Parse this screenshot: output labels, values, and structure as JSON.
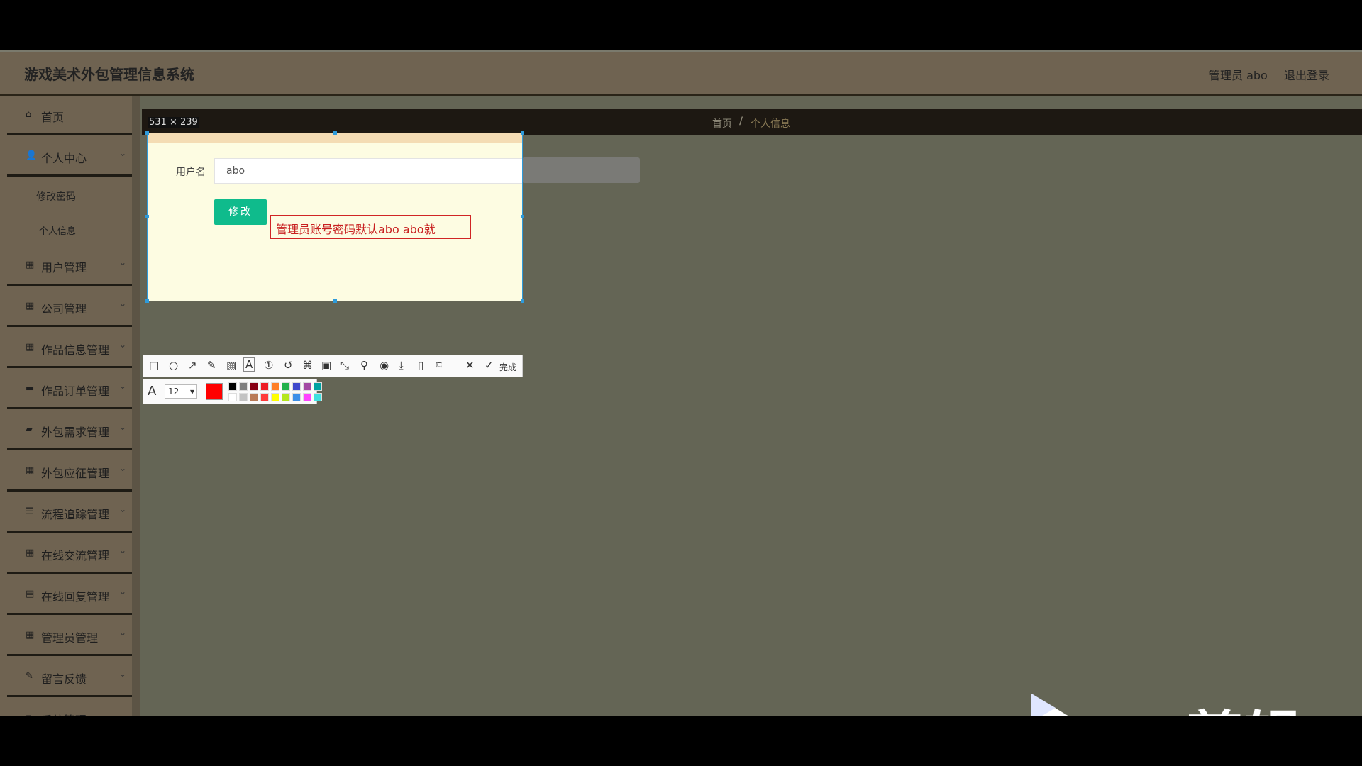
{
  "header": {
    "title": "游戏美术外包管理信息系统",
    "admin_label": "管理员 abo",
    "logout_label": "退出登录"
  },
  "sidebar": {
    "items": [
      {
        "label": "首页",
        "icon": "home-icon"
      },
      {
        "label": "个人中心",
        "icon": "user-icon"
      },
      {
        "label": "用户管理",
        "icon": "grid-icon"
      },
      {
        "label": "公司管理",
        "icon": "grid-icon"
      },
      {
        "label": "作品信息管理",
        "icon": "grid-icon"
      },
      {
        "label": "作品订单管理",
        "icon": "monitor-icon"
      },
      {
        "label": "外包需求管理",
        "icon": "briefcase-icon"
      },
      {
        "label": "外包应征管理",
        "icon": "grid-icon"
      },
      {
        "label": "流程追踪管理",
        "icon": "list-icon"
      },
      {
        "label": "在线交流管理",
        "icon": "grid-icon"
      },
      {
        "label": "在线回复管理",
        "icon": "clipboard-icon"
      },
      {
        "label": "管理员管理",
        "icon": "grid-icon"
      },
      {
        "label": "留言反馈",
        "icon": "feedback-icon"
      },
      {
        "label": "系统管理",
        "icon": "settings-icon"
      }
    ],
    "subitems": [
      {
        "label": "修改密码"
      },
      {
        "label": "个人信息"
      }
    ]
  },
  "breadcrumb": {
    "home": "首页",
    "separator": "/",
    "current": "个人信息"
  },
  "capture": {
    "size_label": "531 × 239",
    "form": {
      "username_label": "用户名",
      "username_value": "abo",
      "submit_label": "修改"
    },
    "annotation_text": "管理员账号密码默认abo abo就",
    "font_size": "12",
    "current_color": "#ff0000",
    "tools": [
      "rectangle-icon",
      "ellipse-icon",
      "arrow-icon",
      "pencil-icon",
      "mosaic-icon",
      "text-icon",
      "number-icon",
      "undo-icon",
      "translate-icon",
      "ocr-icon",
      "long-capture-icon",
      "pin-icon",
      "record-icon",
      "download-icon",
      "copy-icon",
      "bookmark-icon",
      "close-icon"
    ],
    "done_label": "完成",
    "palette": [
      "#000000",
      "#7f7f7f",
      "#880015",
      "#ed1c24",
      "#ff7f27",
      "#22b14c",
      "#3f48cc",
      "#a349a4",
      "#00a2a2",
      "#ffffff",
      "#c3c3c3",
      "#b97a57",
      "#ff3a3a",
      "#ffff00",
      "#b5e61d",
      "#3d8fe8",
      "#ff44ff",
      "#3fe0e0"
    ]
  },
  "watermark": {
    "text": "eV剪辑"
  }
}
